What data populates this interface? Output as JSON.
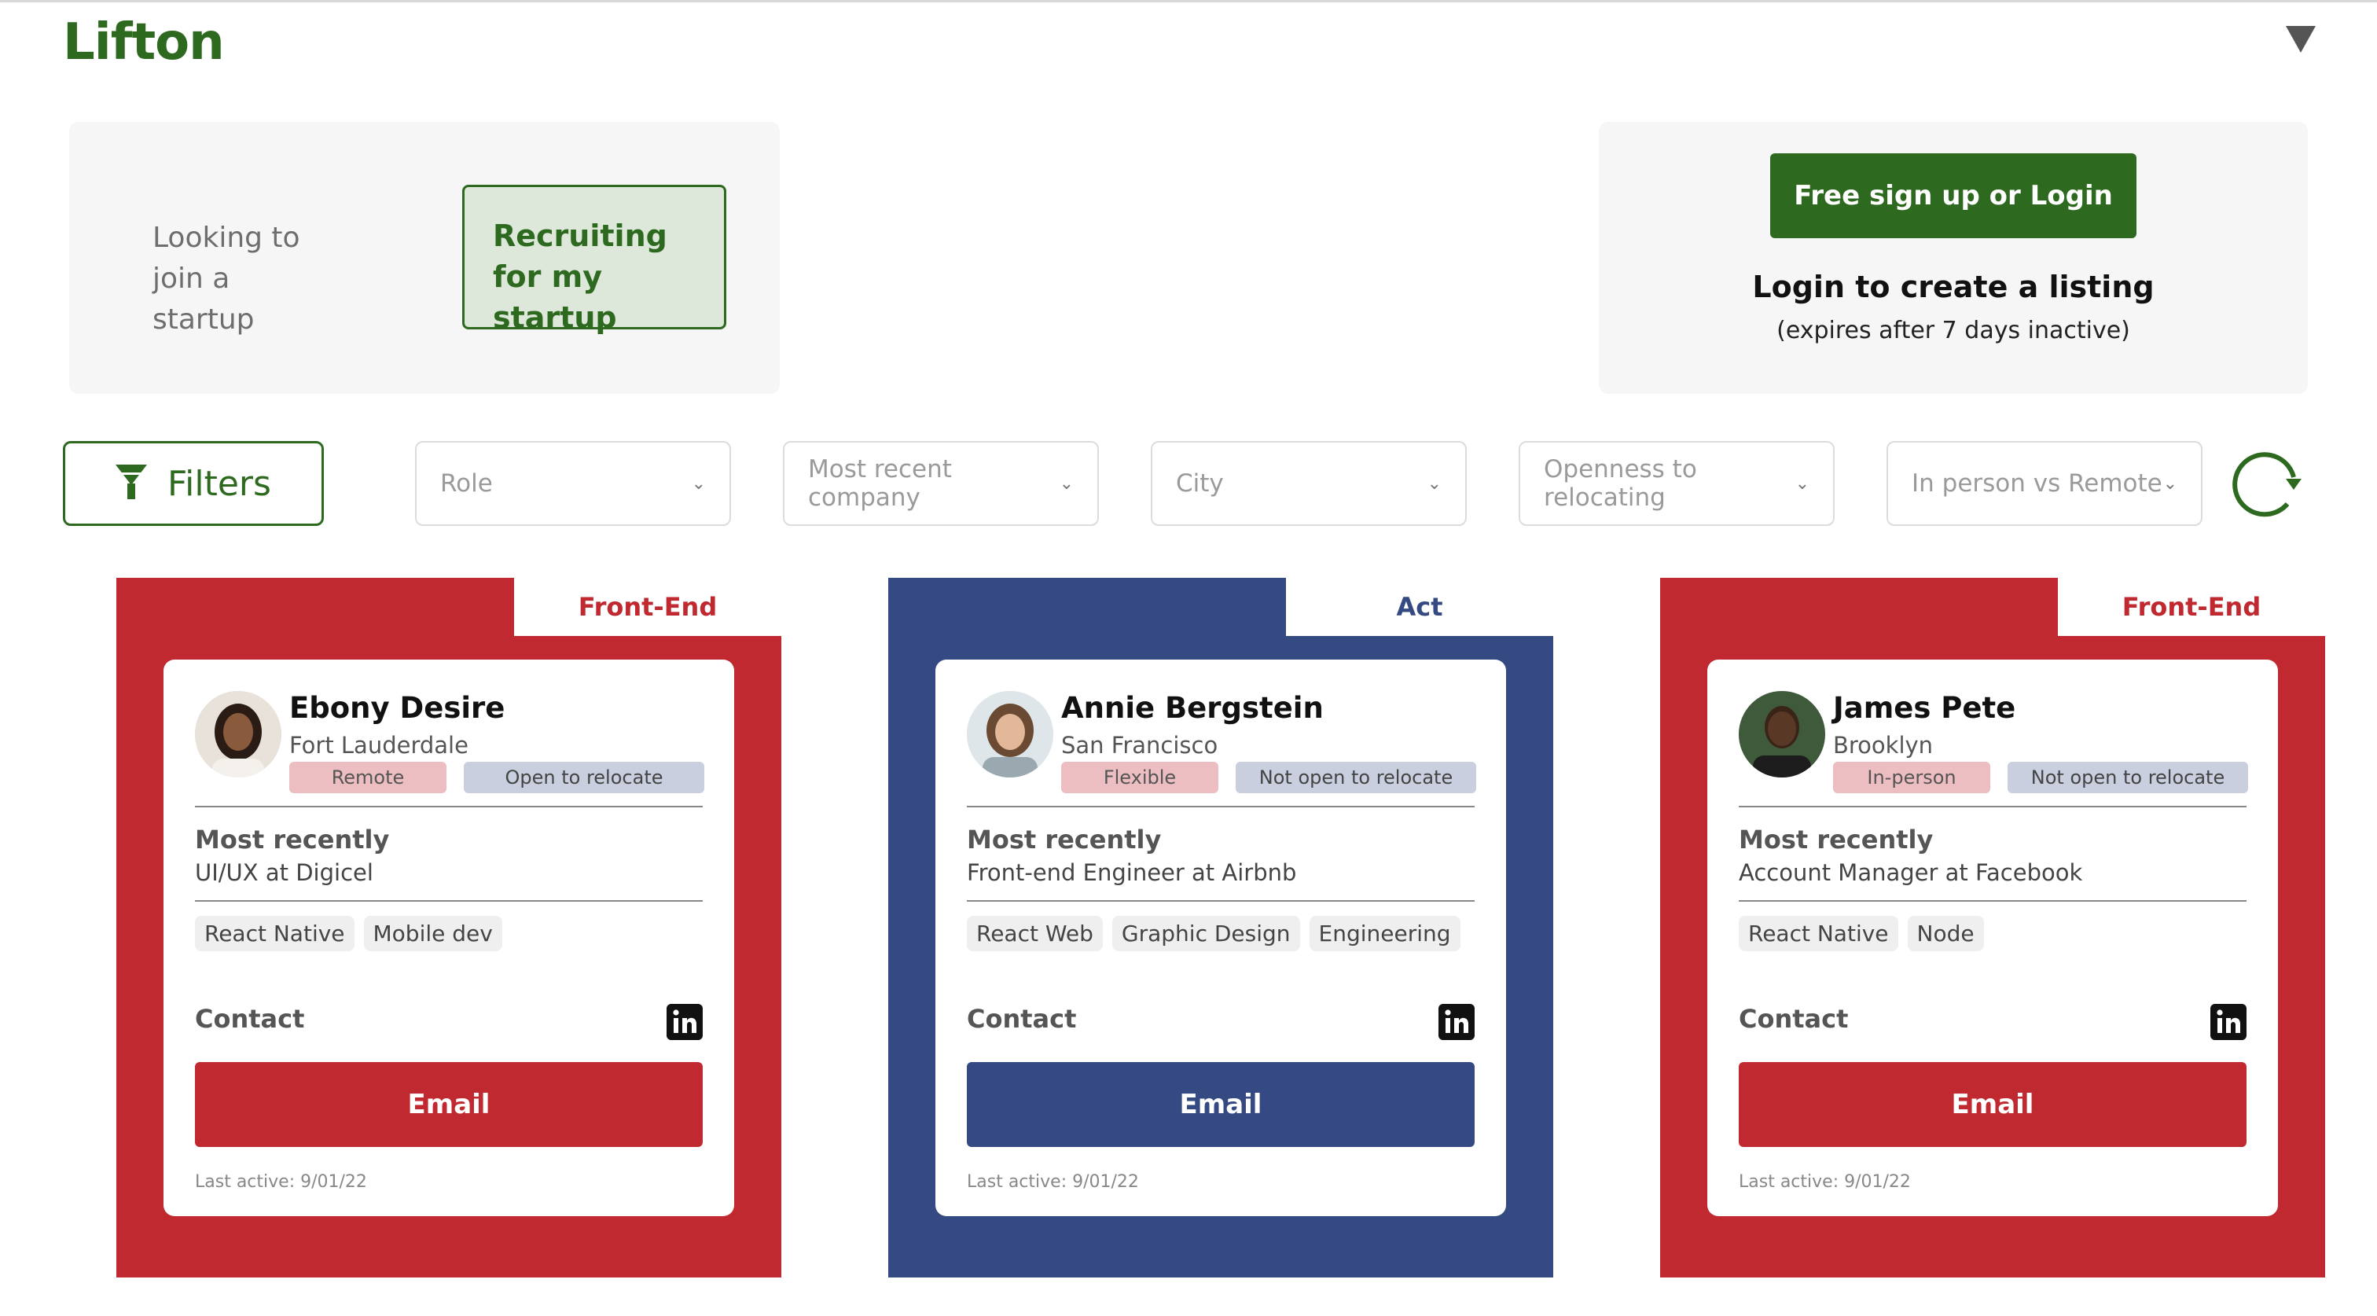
{
  "header": {
    "logo": "Lifton",
    "menu_icon": "caret-down-icon"
  },
  "mode_panel": {
    "joining_label": "Looking to join a startup",
    "recruiting_label": "Recruiting for my startup",
    "selected": "recruiting"
  },
  "login_panel": {
    "signup_button": "Free sign up or Login",
    "title": "Login to create a listing",
    "subtitle": "(expires after 7 days inactive)"
  },
  "filters": {
    "button_label": "Filters",
    "button_icon": "funnel-icon",
    "selects": [
      {
        "placeholder": "Role"
      },
      {
        "placeholder": "Most recent company"
      },
      {
        "placeholder": "City"
      },
      {
        "placeholder": "Openness to relocating"
      },
      {
        "placeholder": "In person vs Remote"
      }
    ],
    "refresh_icon": "refresh-icon"
  },
  "colors": {
    "brand": "#2d6a1f",
    "red": "#c0292f",
    "blue": "#354a82",
    "pill_work": "#ecbdc1",
    "pill_relocate": "#c9cfdf"
  },
  "cards": [
    {
      "role": "Front-End",
      "theme": "#c0292f",
      "name": "Ebony Desire",
      "city": "Fort Lauderdale",
      "work_mode": "Remote",
      "relocation": "Open to relocate",
      "most_recently_label": "Most recently",
      "most_recently": "UI/UX at Digicel",
      "skills": [
        "React Native",
        "Mobile dev"
      ],
      "contact_label": "Contact",
      "email_label": "Email",
      "last_active": "Last active: 9/01/22"
    },
    {
      "role": "Act",
      "theme": "#354a82",
      "name": "Annie Bergstein",
      "city": "San Francisco",
      "work_mode": "Flexible",
      "relocation": "Not open to relocate",
      "most_recently_label": "Most recently",
      "most_recently": "Front-end Engineer at Airbnb",
      "skills": [
        "React Web",
        "Graphic Design",
        "Engineering"
      ],
      "contact_label": "Contact",
      "email_label": "Email",
      "last_active": "Last active: 9/01/22"
    },
    {
      "role": "Front-End",
      "theme": "#c0292f",
      "name": "James Pete",
      "city": "Brooklyn",
      "work_mode": "In-person",
      "relocation": "Not open to relocate",
      "most_recently_label": "Most recently",
      "most_recently": "Account Manager at Facebook",
      "skills": [
        "React Native",
        "Node"
      ],
      "contact_label": "Contact",
      "email_label": "Email",
      "last_active": "Last active: 9/01/22"
    }
  ]
}
